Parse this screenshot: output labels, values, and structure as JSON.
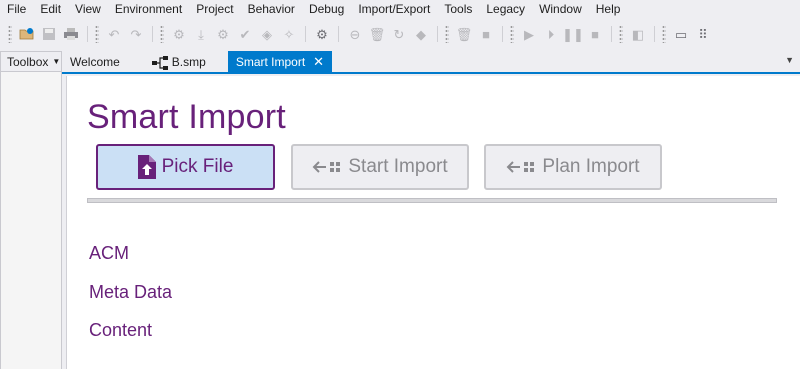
{
  "menu": [
    "File",
    "Edit",
    "View",
    "Environment",
    "Project",
    "Behavior",
    "Debug",
    "Import/Export",
    "Tools",
    "Legacy",
    "Window",
    "Help"
  ],
  "toolbox": {
    "label": "Toolbox"
  },
  "tabs": [
    {
      "label": "Welcome"
    },
    {
      "label": "B.smp"
    },
    {
      "label": "Smart Import"
    }
  ],
  "page": {
    "title": "Smart Import",
    "buttons": {
      "pick": "Pick File",
      "start": "Start Import",
      "plan": "Plan Import"
    },
    "links": [
      "ACM",
      "Meta Data",
      "Content"
    ]
  },
  "colors": {
    "accent": "#68217a",
    "tab_active": "#007acc",
    "pick_bg": "#cbe0f5"
  }
}
